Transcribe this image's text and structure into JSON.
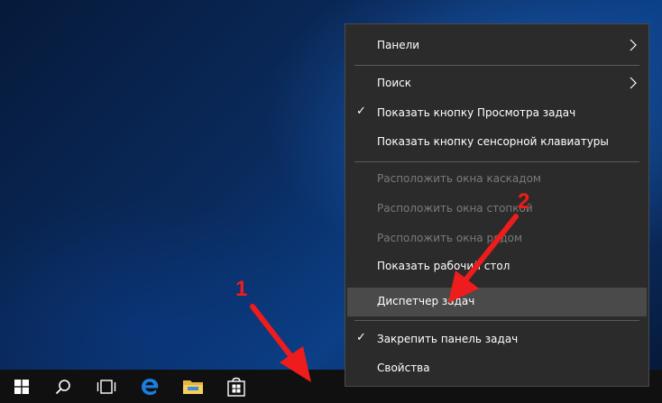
{
  "menu": {
    "items": [
      {
        "label": "Панели",
        "checked": false,
        "disabled": false,
        "submenu": true,
        "highlighted": false
      },
      {
        "label": "Поиск",
        "checked": false,
        "disabled": false,
        "submenu": true,
        "highlighted": false
      },
      {
        "label": "Показать кнопку Просмотра задач",
        "checked": true,
        "disabled": false,
        "submenu": false,
        "highlighted": false
      },
      {
        "label": "Показать кнопку сенсорной клавиатуры",
        "checked": false,
        "disabled": false,
        "submenu": false,
        "highlighted": false
      },
      {
        "label": "Расположить окна каскадом",
        "checked": false,
        "disabled": true,
        "submenu": false,
        "highlighted": false
      },
      {
        "label": "Расположить окна стопкой",
        "checked": false,
        "disabled": true,
        "submenu": false,
        "highlighted": false
      },
      {
        "label": "Расположить окна рядом",
        "checked": false,
        "disabled": true,
        "submenu": false,
        "highlighted": false
      },
      {
        "label": "Показать рабочий стол",
        "checked": false,
        "disabled": false,
        "submenu": false,
        "highlighted": false
      },
      {
        "label": "Диспетчер задач",
        "checked": false,
        "disabled": false,
        "submenu": false,
        "highlighted": true
      },
      {
        "label": "Закрепить панель задач",
        "checked": true,
        "disabled": false,
        "submenu": false,
        "highlighted": false
      },
      {
        "label": "Свойства",
        "checked": false,
        "disabled": false,
        "submenu": false,
        "highlighted": false
      }
    ],
    "check_glyph": "✓"
  },
  "taskbar": {
    "icons": [
      "windows-start-icon",
      "search-icon",
      "task-view-icon",
      "edge-icon",
      "file-explorer-icon",
      "store-icon"
    ]
  },
  "annotations": {
    "label_1": "1",
    "label_2": "2",
    "color": "#ee1c1c"
  }
}
